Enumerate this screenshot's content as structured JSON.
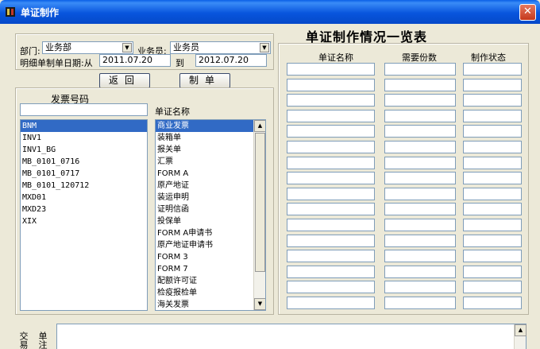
{
  "window": {
    "title": "单证制作",
    "close_glyph": "✕",
    "app_icon": "app-book-icon"
  },
  "filter": {
    "dept_label": "部门:",
    "dept_value": "业务部",
    "clerk_label": "业务员:",
    "clerk_value": "业务员",
    "date_label": "明细单制单日期:从",
    "date_from": "2011.07.20",
    "date_to_label": "到",
    "date_to": "2012.07.20"
  },
  "buttons": {
    "back": "返回",
    "make": "制单"
  },
  "invoice": {
    "label": "发票号码",
    "search_value": "",
    "items": [
      "BNM",
      "INV1",
      "INV1_BG",
      "MB_0101_0716",
      "MB_0101_0717",
      "MB_0101_120712",
      "MXD01",
      "MXD23",
      "XIX"
    ],
    "selected_index": 0
  },
  "doc_names": {
    "label": "单证名称",
    "items": [
      "商业发票",
      "装箱单",
      "报关单",
      "汇票",
      "FORM A",
      "原产地证",
      "装运申明",
      "证明信函",
      "投保单",
      "FORM A申请书",
      "原产地证申请书",
      "FORM 3",
      "FORM 7",
      "配额许可证",
      "检疫报检单",
      "海关发票"
    ],
    "selected_index": 0
  },
  "overview": {
    "title": "单证制作情况一览表",
    "columns": [
      "单证名称",
      "需要份数",
      "制作状态"
    ],
    "row_count": 16
  },
  "bottom": {
    "side_label_1": "交易",
    "side_label_2": "单注",
    "memo_value": ""
  }
}
